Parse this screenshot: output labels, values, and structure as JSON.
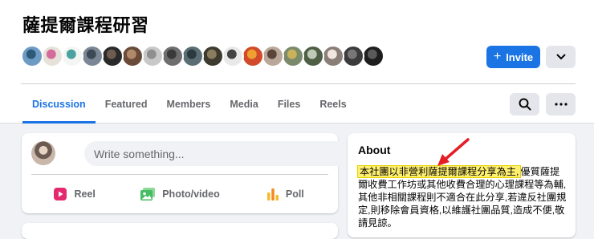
{
  "group": {
    "title": "薩提爾課程研習"
  },
  "members": [
    {
      "color": "#6d9bc4",
      "accent": "#2e5a7a"
    },
    {
      "color": "#e7e2d9",
      "accent": "#d46b9a"
    },
    {
      "color": "#f3f6f2",
      "accent": "#4aa3a0"
    },
    {
      "color": "#7b8794",
      "accent": "#3d4a55"
    },
    {
      "color": "#2a2a2a",
      "accent": "#6d5c4f"
    },
    {
      "color": "#6a4b3a",
      "accent": "#b08968"
    },
    {
      "color": "#c8c8c8",
      "accent": "#8f8f8f"
    },
    {
      "color": "#6e6e6e",
      "accent": "#3a3a3a"
    },
    {
      "color": "#5b6e74",
      "accent": "#2b3a3f"
    },
    {
      "color": "#3e3a30",
      "accent": "#8a7d5e"
    },
    {
      "color": "#e9e9e9",
      "accent": "#444444"
    },
    {
      "color": "#d14b2a",
      "accent": "#f0a030"
    },
    {
      "color": "#b9a79a",
      "accent": "#5a4638"
    },
    {
      "color": "#7a8a6b",
      "accent": "#c9b35a"
    },
    {
      "color": "#4f5f45",
      "accent": "#c0c9b8"
    },
    {
      "color": "#8a7e78",
      "accent": "#f2e6e0"
    },
    {
      "color": "#3b3b3b",
      "accent": "#777777"
    },
    {
      "color": "#1e1e1e",
      "accent": "#5a5a5a"
    }
  ],
  "buttons": {
    "invite": "Invite"
  },
  "tabs": [
    "Discussion",
    "Featured",
    "Members",
    "Media",
    "Files",
    "Reels"
  ],
  "composer": {
    "placeholder": "Write something...",
    "actions": [
      "Reel",
      "Photo/video",
      "Poll"
    ]
  },
  "about": {
    "title": "About",
    "highlighted": "本社團以非營利薩提爾課程分享為主,",
    "rest": "優質薩提爾收費工作坊或其他收費合理的心理課程等為輔,其他非相關課程則不適合在此分享,若違反社團規定,則移除會員資格,以維護社團品質,造成不便,敬請見諒。"
  },
  "colors": {
    "accent": "#1b74e4",
    "highlight": "#fff06e",
    "arrow": "#e41e26"
  }
}
